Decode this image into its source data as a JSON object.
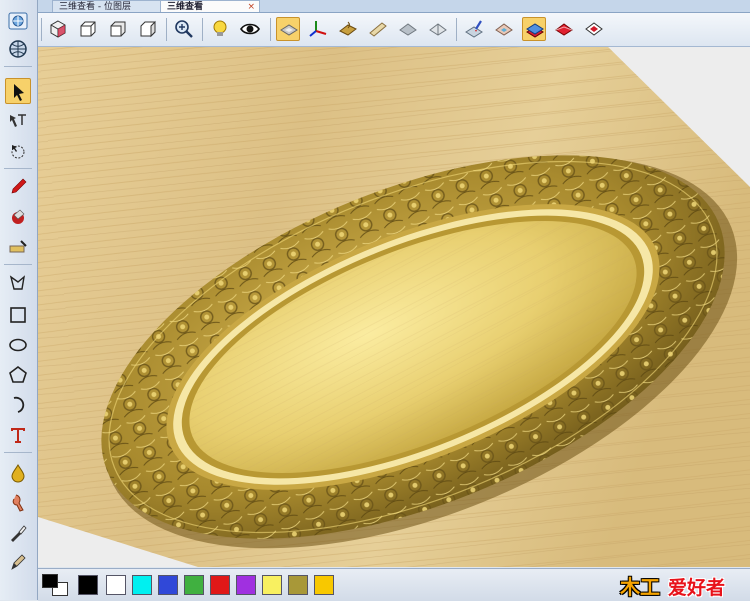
{
  "tabs": [
    {
      "label": "三维查看 - 位图层",
      "active": false
    },
    {
      "label": "三维查看",
      "active": true
    }
  ],
  "tab_close_glyph": "×",
  "toolbar": {
    "buttons": [
      {
        "name": "iso-view-icon"
      },
      {
        "name": "top-view-icon"
      },
      {
        "name": "front-view-icon"
      },
      {
        "name": "side-view-icon"
      },
      {
        "name": "zoom-icon"
      },
      {
        "name": "light-bulb-icon"
      },
      {
        "name": "eye-icon"
      },
      {
        "name": "relief-view-icon",
        "active": true
      },
      {
        "name": "axes-icon"
      },
      {
        "name": "texture-block-icon"
      },
      {
        "name": "wood-plank-icon"
      },
      {
        "name": "grey-material-icon"
      },
      {
        "name": "grey-outline-icon"
      },
      {
        "name": "paint-brush-icon"
      },
      {
        "name": "material-layer-icon"
      },
      {
        "name": "layer-stack-icon",
        "active": true
      },
      {
        "name": "red-layer-icon"
      },
      {
        "name": "red-diamond-icon"
      }
    ]
  },
  "left_tools": [
    {
      "name": "globe-view-icon"
    },
    {
      "name": "globe-icon"
    },
    {
      "name": "select-arrow-icon",
      "active": true
    },
    {
      "name": "node-edit-icon"
    },
    {
      "name": "transform-icon"
    },
    {
      "name": "pen-icon"
    },
    {
      "name": "fill-icon"
    },
    {
      "name": "measure-icon"
    },
    {
      "name": "polyline-icon"
    },
    {
      "name": "rectangle-icon"
    },
    {
      "name": "ellipse-icon"
    },
    {
      "name": "polygon-icon"
    },
    {
      "name": "arc-icon"
    },
    {
      "name": "text-icon"
    },
    {
      "name": "drop-icon"
    },
    {
      "name": "sculpt-icon"
    },
    {
      "name": "brush-tool-icon"
    },
    {
      "name": "pencil-tool-icon"
    }
  ],
  "palette": {
    "colors": [
      "#000000",
      "#ffffff",
      "#00f0f0",
      "#3048d8",
      "#40b040",
      "#e01818",
      "#a030e0",
      "#f8f060",
      "#a89838",
      "#f8c800"
    ]
  },
  "watermark": {
    "part1": "木工",
    "part2": "爱好者"
  }
}
